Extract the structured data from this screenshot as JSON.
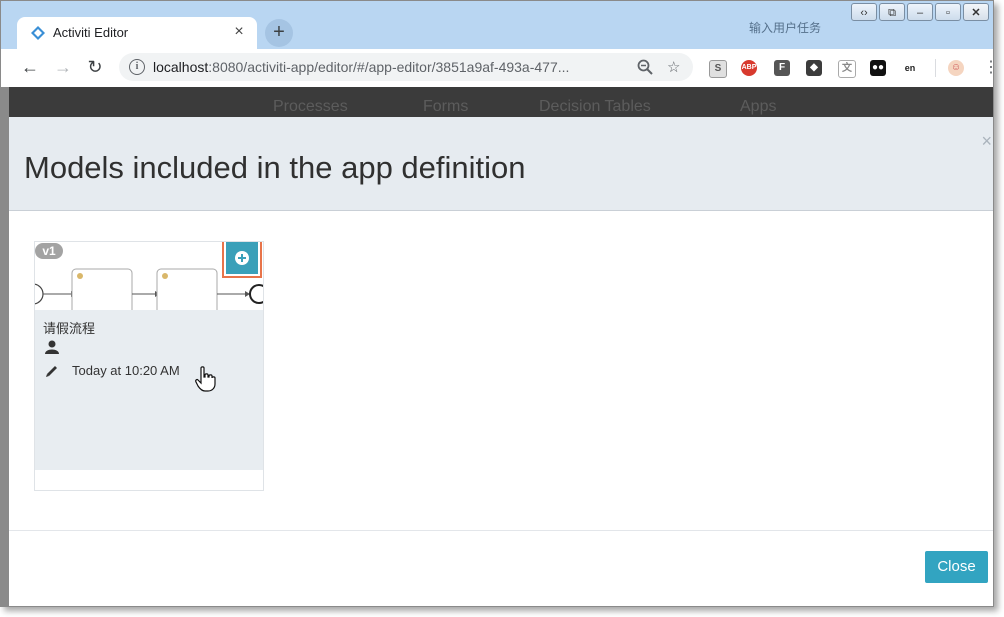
{
  "browser": {
    "tab_title": "Activiti Editor",
    "new_tab_symbol": "+",
    "tab_close_symbol": "×",
    "background_window_text": "输入用户任务",
    "url_host": "localhost",
    "url_rest": ":8080/activiti-app/editor/#/app-editor/3851a9af-493a-477...",
    "extensions": [
      "S",
      "ABP",
      "F",
      "en"
    ]
  },
  "app_nav": {
    "items": [
      "Processes",
      "Forms",
      "Decision Tables",
      "Apps"
    ]
  },
  "modal": {
    "title": "Models included in the app definition",
    "close_x": "×",
    "close_button_label": "Close"
  },
  "model_card": {
    "version": "v1",
    "name": "请假流程",
    "modified": "Today at 10:20 AM"
  },
  "colors": {
    "accent": "#32a4c1",
    "highlight_border": "#e8744a",
    "header_bg": "#e6ebf0",
    "card_bg": "#e8edf1"
  }
}
